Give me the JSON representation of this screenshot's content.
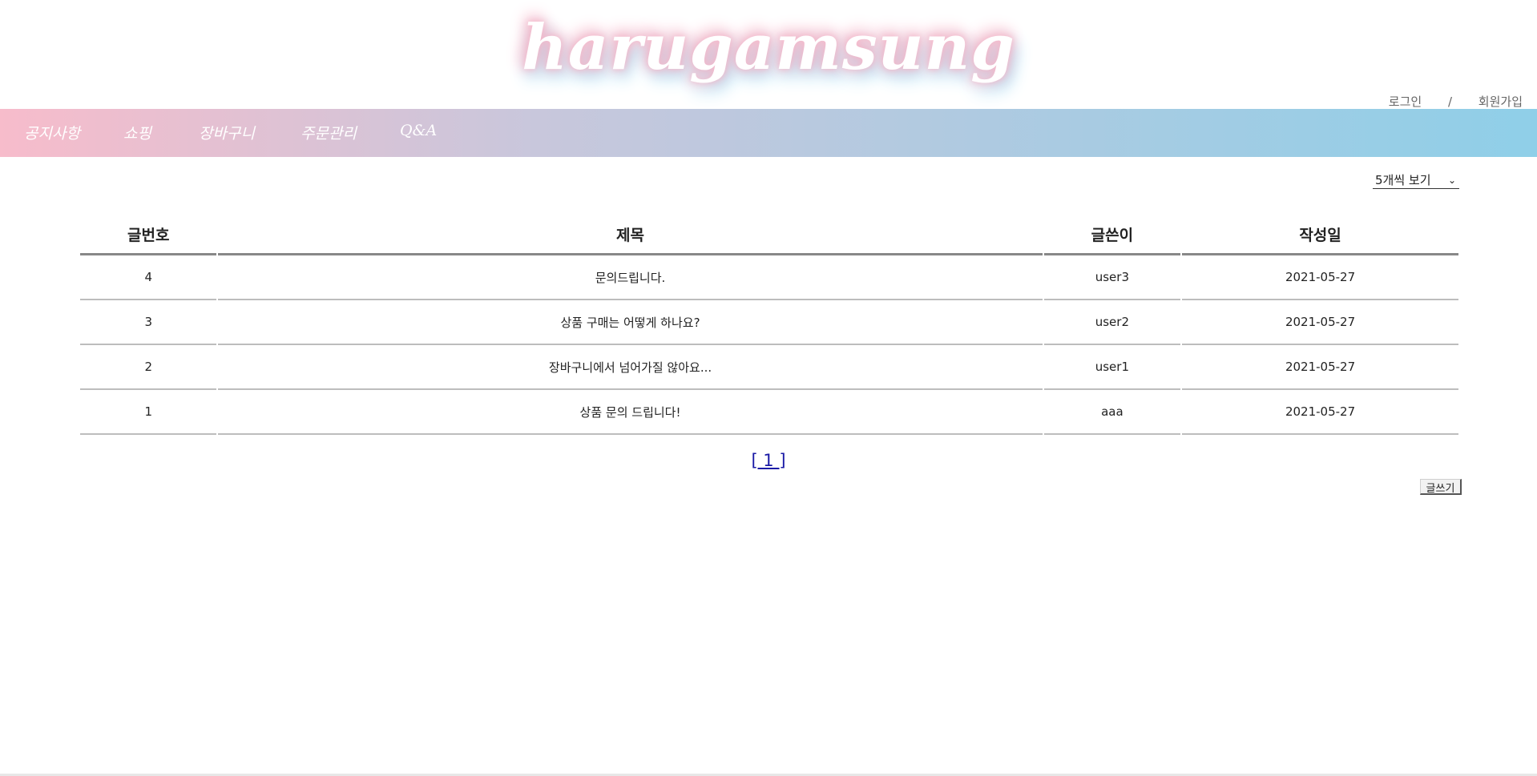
{
  "header": {
    "logo_text": "harugamsung",
    "login_label": "로그인",
    "separator": "/",
    "signup_label": "회원가입"
  },
  "nav": {
    "items": [
      {
        "label": "공지사항"
      },
      {
        "label": "쇼핑"
      },
      {
        "label": "장바구니"
      },
      {
        "label": "주문관리"
      },
      {
        "label": "Q&A"
      }
    ],
    "colors": {
      "left": "#f7bccb",
      "right": "#8fcfe8"
    }
  },
  "board": {
    "per_page_selected": "5개씩 보기",
    "columns": [
      "글번호",
      "제목",
      "글쓴이",
      "작성일"
    ],
    "rows": [
      {
        "no": "4",
        "title": "문의드립니다.",
        "writer": "user3",
        "date": "2021-05-27"
      },
      {
        "no": "3",
        "title": "상품 구매는 어떻게 하나요?",
        "writer": "user2",
        "date": "2021-05-27"
      },
      {
        "no": "2",
        "title": "장바구니에서 넘어가질 않아요...",
        "writer": "user1",
        "date": "2021-05-27"
      },
      {
        "no": "1",
        "title": "상품 문의 드립니다!",
        "writer": "aaa",
        "date": "2021-05-27"
      }
    ]
  },
  "pagination": {
    "current_page_label": "[ 1 ]"
  },
  "actions": {
    "write_label": "글쓰기"
  }
}
